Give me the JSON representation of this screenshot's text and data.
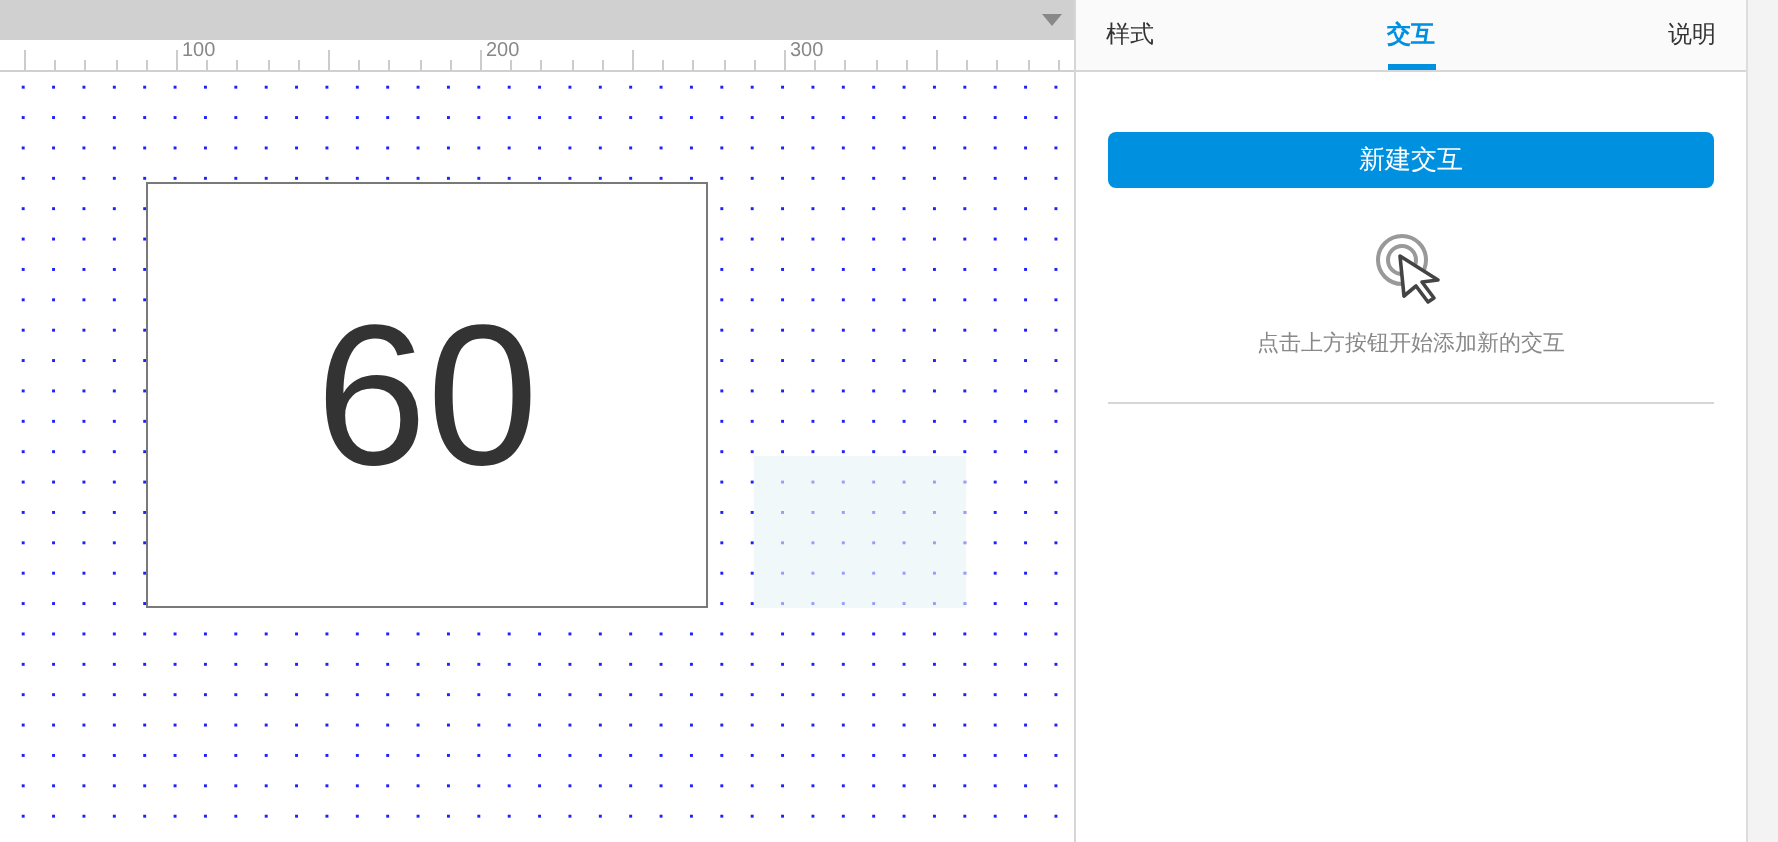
{
  "ruler": {
    "labels": [
      "100",
      "200",
      "300"
    ]
  },
  "canvas": {
    "widgets": [
      {
        "kind": "box",
        "text": "60"
      },
      {
        "kind": "hotspot"
      }
    ]
  },
  "panel": {
    "tabs": [
      {
        "label": "样式",
        "selected": false
      },
      {
        "label": "交互",
        "selected": true
      },
      {
        "label": "说明",
        "selected": false
      }
    ],
    "new_button": "新建交互",
    "hint": "点击上方按钮开始添加新的交互"
  }
}
